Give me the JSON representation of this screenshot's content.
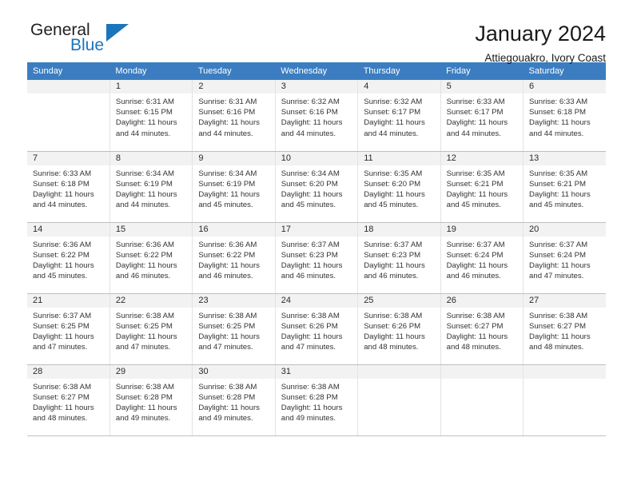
{
  "brand": {
    "name_part1": "General",
    "name_part2": "Blue",
    "triangle_icon": "triangle-icon",
    "accent_color": "#1b75bb"
  },
  "header": {
    "title": "January 2024",
    "subtitle": "Attiegouakro, Ivory Coast"
  },
  "calendar": {
    "header_bg": "#3b7dc0",
    "daynum_bg": "#f2f2f2",
    "weekday_headers": [
      "Sunday",
      "Monday",
      "Tuesday",
      "Wednesday",
      "Thursday",
      "Friday",
      "Saturday"
    ],
    "weeks": [
      [
        {
          "day": "",
          "sunrise": "",
          "sunset": "",
          "daylight_line1": "",
          "daylight_line2": "",
          "empty": true
        },
        {
          "day": "1",
          "sunrise": "Sunrise: 6:31 AM",
          "sunset": "Sunset: 6:15 PM",
          "daylight_line1": "Daylight: 11 hours",
          "daylight_line2": "and 44 minutes."
        },
        {
          "day": "2",
          "sunrise": "Sunrise: 6:31 AM",
          "sunset": "Sunset: 6:16 PM",
          "daylight_line1": "Daylight: 11 hours",
          "daylight_line2": "and 44 minutes."
        },
        {
          "day": "3",
          "sunrise": "Sunrise: 6:32 AM",
          "sunset": "Sunset: 6:16 PM",
          "daylight_line1": "Daylight: 11 hours",
          "daylight_line2": "and 44 minutes."
        },
        {
          "day": "4",
          "sunrise": "Sunrise: 6:32 AM",
          "sunset": "Sunset: 6:17 PM",
          "daylight_line1": "Daylight: 11 hours",
          "daylight_line2": "and 44 minutes."
        },
        {
          "day": "5",
          "sunrise": "Sunrise: 6:33 AM",
          "sunset": "Sunset: 6:17 PM",
          "daylight_line1": "Daylight: 11 hours",
          "daylight_line2": "and 44 minutes."
        },
        {
          "day": "6",
          "sunrise": "Sunrise: 6:33 AM",
          "sunset": "Sunset: 6:18 PM",
          "daylight_line1": "Daylight: 11 hours",
          "daylight_line2": "and 44 minutes."
        }
      ],
      [
        {
          "day": "7",
          "sunrise": "Sunrise: 6:33 AM",
          "sunset": "Sunset: 6:18 PM",
          "daylight_line1": "Daylight: 11 hours",
          "daylight_line2": "and 44 minutes."
        },
        {
          "day": "8",
          "sunrise": "Sunrise: 6:34 AM",
          "sunset": "Sunset: 6:19 PM",
          "daylight_line1": "Daylight: 11 hours",
          "daylight_line2": "and 44 minutes."
        },
        {
          "day": "9",
          "sunrise": "Sunrise: 6:34 AM",
          "sunset": "Sunset: 6:19 PM",
          "daylight_line1": "Daylight: 11 hours",
          "daylight_line2": "and 45 minutes."
        },
        {
          "day": "10",
          "sunrise": "Sunrise: 6:34 AM",
          "sunset": "Sunset: 6:20 PM",
          "daylight_line1": "Daylight: 11 hours",
          "daylight_line2": "and 45 minutes."
        },
        {
          "day": "11",
          "sunrise": "Sunrise: 6:35 AM",
          "sunset": "Sunset: 6:20 PM",
          "daylight_line1": "Daylight: 11 hours",
          "daylight_line2": "and 45 minutes."
        },
        {
          "day": "12",
          "sunrise": "Sunrise: 6:35 AM",
          "sunset": "Sunset: 6:21 PM",
          "daylight_line1": "Daylight: 11 hours",
          "daylight_line2": "and 45 minutes."
        },
        {
          "day": "13",
          "sunrise": "Sunrise: 6:35 AM",
          "sunset": "Sunset: 6:21 PM",
          "daylight_line1": "Daylight: 11 hours",
          "daylight_line2": "and 45 minutes."
        }
      ],
      [
        {
          "day": "14",
          "sunrise": "Sunrise: 6:36 AM",
          "sunset": "Sunset: 6:22 PM",
          "daylight_line1": "Daylight: 11 hours",
          "daylight_line2": "and 45 minutes."
        },
        {
          "day": "15",
          "sunrise": "Sunrise: 6:36 AM",
          "sunset": "Sunset: 6:22 PM",
          "daylight_line1": "Daylight: 11 hours",
          "daylight_line2": "and 46 minutes."
        },
        {
          "day": "16",
          "sunrise": "Sunrise: 6:36 AM",
          "sunset": "Sunset: 6:22 PM",
          "daylight_line1": "Daylight: 11 hours",
          "daylight_line2": "and 46 minutes."
        },
        {
          "day": "17",
          "sunrise": "Sunrise: 6:37 AM",
          "sunset": "Sunset: 6:23 PM",
          "daylight_line1": "Daylight: 11 hours",
          "daylight_line2": "and 46 minutes."
        },
        {
          "day": "18",
          "sunrise": "Sunrise: 6:37 AM",
          "sunset": "Sunset: 6:23 PM",
          "daylight_line1": "Daylight: 11 hours",
          "daylight_line2": "and 46 minutes."
        },
        {
          "day": "19",
          "sunrise": "Sunrise: 6:37 AM",
          "sunset": "Sunset: 6:24 PM",
          "daylight_line1": "Daylight: 11 hours",
          "daylight_line2": "and 46 minutes."
        },
        {
          "day": "20",
          "sunrise": "Sunrise: 6:37 AM",
          "sunset": "Sunset: 6:24 PM",
          "daylight_line1": "Daylight: 11 hours",
          "daylight_line2": "and 47 minutes."
        }
      ],
      [
        {
          "day": "21",
          "sunrise": "Sunrise: 6:37 AM",
          "sunset": "Sunset: 6:25 PM",
          "daylight_line1": "Daylight: 11 hours",
          "daylight_line2": "and 47 minutes."
        },
        {
          "day": "22",
          "sunrise": "Sunrise: 6:38 AM",
          "sunset": "Sunset: 6:25 PM",
          "daylight_line1": "Daylight: 11 hours",
          "daylight_line2": "and 47 minutes."
        },
        {
          "day": "23",
          "sunrise": "Sunrise: 6:38 AM",
          "sunset": "Sunset: 6:25 PM",
          "daylight_line1": "Daylight: 11 hours",
          "daylight_line2": "and 47 minutes."
        },
        {
          "day": "24",
          "sunrise": "Sunrise: 6:38 AM",
          "sunset": "Sunset: 6:26 PM",
          "daylight_line1": "Daylight: 11 hours",
          "daylight_line2": "and 47 minutes."
        },
        {
          "day": "25",
          "sunrise": "Sunrise: 6:38 AM",
          "sunset": "Sunset: 6:26 PM",
          "daylight_line1": "Daylight: 11 hours",
          "daylight_line2": "and 48 minutes."
        },
        {
          "day": "26",
          "sunrise": "Sunrise: 6:38 AM",
          "sunset": "Sunset: 6:27 PM",
          "daylight_line1": "Daylight: 11 hours",
          "daylight_line2": "and 48 minutes."
        },
        {
          "day": "27",
          "sunrise": "Sunrise: 6:38 AM",
          "sunset": "Sunset: 6:27 PM",
          "daylight_line1": "Daylight: 11 hours",
          "daylight_line2": "and 48 minutes."
        }
      ],
      [
        {
          "day": "28",
          "sunrise": "Sunrise: 6:38 AM",
          "sunset": "Sunset: 6:27 PM",
          "daylight_line1": "Daylight: 11 hours",
          "daylight_line2": "and 48 minutes."
        },
        {
          "day": "29",
          "sunrise": "Sunrise: 6:38 AM",
          "sunset": "Sunset: 6:28 PM",
          "daylight_line1": "Daylight: 11 hours",
          "daylight_line2": "and 49 minutes."
        },
        {
          "day": "30",
          "sunrise": "Sunrise: 6:38 AM",
          "sunset": "Sunset: 6:28 PM",
          "daylight_line1": "Daylight: 11 hours",
          "daylight_line2": "and 49 minutes."
        },
        {
          "day": "31",
          "sunrise": "Sunrise: 6:38 AM",
          "sunset": "Sunset: 6:28 PM",
          "daylight_line1": "Daylight: 11 hours",
          "daylight_line2": "and 49 minutes."
        },
        {
          "day": "",
          "sunrise": "",
          "sunset": "",
          "daylight_line1": "",
          "daylight_line2": "",
          "empty": true
        },
        {
          "day": "",
          "sunrise": "",
          "sunset": "",
          "daylight_line1": "",
          "daylight_line2": "",
          "empty": true
        },
        {
          "day": "",
          "sunrise": "",
          "sunset": "",
          "daylight_line1": "",
          "daylight_line2": "",
          "empty": true
        }
      ]
    ]
  }
}
